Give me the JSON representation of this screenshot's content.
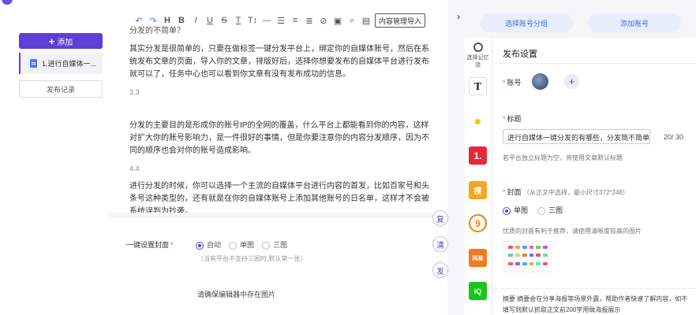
{
  "left": {
    "add_label": "添加",
    "article_title": "1.进行自媒体一...",
    "history_label": "发布记录"
  },
  "toolbar": {
    "import_label": "内容管理导入"
  },
  "editor": {
    "top_partial": "分发的不简单？",
    "para1": "其实分发是很简单的，只要在做标签一键分发平台上，绑定你的自媒体账号，然后在系统发布文章的页面，导入你的文章，排版好后，选择你想要发布的自媒体平台进行发布就可以了，任务中心也可以看到你文章有没有发布成功的信息。",
    "num1": "3.3",
    "para2": "分发的主要目的是形成你的账号IP的全网的覆盖，什么平台上都能看到你的内容，这样对扩大你的账号影响力，是一件很好的事情，但是你要注意你的内容分发顺序，因为不同的顺序也会对你的账号造成影响。",
    "num2": "4.4",
    "para3": "进行分发的时候，你可以选择一个主流的自媒体平台进行内容的首发，比如百家号和头条号这种类型的，还有就是在你的自媒体账号上添加其他账号的日名单，这样才不会被系统误判为抄袭。"
  },
  "cover": {
    "label": "一键设置封面",
    "options": [
      "自动",
      "单图",
      "三图"
    ],
    "hint": "（当有平台不支持三图时,默认第一张）",
    "note": "请确保编辑器中存在图片"
  },
  "float_buttons": [
    "复",
    "清",
    "发"
  ],
  "top_buttons": {
    "select_group": "选择账号分组",
    "add_account": "添加账号"
  },
  "platforms": {
    "header": "选择记忆项",
    "items": [
      {
        "name": "toutiao",
        "glyph": "T",
        "color": "#ffffff"
      },
      {
        "name": "qq",
        "glyph": "🐧",
        "color": "#ffffff"
      },
      {
        "name": "yidian",
        "glyph": "1.",
        "color": "#e8283a"
      },
      {
        "name": "sohu",
        "glyph": "搜",
        "color": "#f5a623"
      },
      {
        "name": "dayu",
        "glyph": "9",
        "color": "#ff7a00"
      },
      {
        "name": "wangyi",
        "glyph": "网",
        "color": "#f47a1f"
      },
      {
        "name": "iqiyi",
        "glyph": "iQ",
        "color": "#19c519"
      }
    ]
  },
  "settings": {
    "title": "发布设置",
    "account_label": "账号",
    "title_label": "标题",
    "title_value": "进行自媒体一键分发的有哪些，分发简不简单",
    "title_counter": "20/ 30",
    "title_hint": "若平台独立标题为空，将使用文章默认标题",
    "cover_label": "封面",
    "cover_sub": "（从正文中选择，最小尺寸372*248）",
    "cover_options": [
      "单图",
      "三图"
    ],
    "cover_hint": "优质的封面有利于推荐，请使用清晰度较高的图片",
    "abstract": "摘要 摘要会在分享海报等场景外露，帮助作者快速了解内容，如不填写则默认抓取正文前200字用做海报展示"
  }
}
